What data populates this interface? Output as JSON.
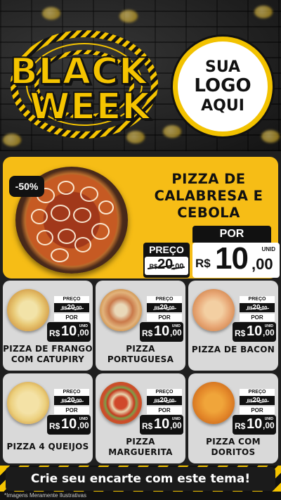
{
  "header": {
    "title_line1": "BLACK",
    "title_line2": "WEEK",
    "logo_line1": "SUA",
    "logo_line2": "LOGO",
    "logo_line3": "AQUI"
  },
  "featured": {
    "discount": "-50%",
    "name_line1": "PIZZA DE",
    "name_line2": "CALABRESA E",
    "name_line3": "CEBOLA",
    "por_label": "POR",
    "preco_label": "PREÇO",
    "old_currency": "R$",
    "old_int": "20",
    "old_dec": ",00",
    "new_currency": "R$",
    "new_int": "10",
    "new_dec": ",00",
    "unit": "UNID"
  },
  "products": [
    {
      "name_line1": "PIZZA DE FRANGO",
      "name_line2": "COM CATUPIRY",
      "preco_label": "PREÇO",
      "old_currency": "R$",
      "old_int": "20",
      "old_dec": ",00",
      "por_label": "POR",
      "new_currency": "R$",
      "new_int": "10",
      "new_dec": ",00",
      "unit": "UNID"
    },
    {
      "name_line1": "PIZZA",
      "name_line2": "PORTUGUESA",
      "preco_label": "PREÇO",
      "old_currency": "R$",
      "old_int": "20",
      "old_dec": ",00",
      "por_label": "POR",
      "new_currency": "R$",
      "new_int": "10",
      "new_dec": ",00",
      "unit": "UNID"
    },
    {
      "name_line1": "PIZZA DE BACON",
      "name_line2": "",
      "preco_label": "PREÇO",
      "old_currency": "R$",
      "old_int": "20",
      "old_dec": ",00",
      "por_label": "POR",
      "new_currency": "R$",
      "new_int": "10",
      "new_dec": ",00",
      "unit": "UNID"
    },
    {
      "name_line1": "PIZZA 4 QUEIJOS",
      "name_line2": "",
      "preco_label": "PREÇO",
      "old_currency": "R$",
      "old_int": "20",
      "old_dec": ",00",
      "por_label": "POR",
      "new_currency": "R$",
      "new_int": "10",
      "new_dec": ",00",
      "unit": "UNID"
    },
    {
      "name_line1": "PIZZA",
      "name_line2": "MARGUERITA",
      "preco_label": "PREÇO",
      "old_currency": "R$",
      "old_int": "20",
      "old_dec": ",00",
      "por_label": "POR",
      "new_currency": "R$",
      "new_int": "10",
      "new_dec": ",00",
      "unit": "UNID"
    },
    {
      "name_line1": "PIZZA COM",
      "name_line2": "DORITOS",
      "preco_label": "PREÇO",
      "old_currency": "R$",
      "old_int": "20",
      "old_dec": ",00",
      "por_label": "POR",
      "new_currency": "R$",
      "new_int": "10",
      "new_dec": ",00",
      "unit": "UNID"
    }
  ],
  "footer": {
    "cta": "Crie seu encarte com este tema!",
    "disclaimer": "*Imagens Meramente Ilustrativas"
  },
  "colors": {
    "accent_yellow": "#f6bd16",
    "dark": "#111111",
    "card_bg": "#d9d9d9"
  }
}
